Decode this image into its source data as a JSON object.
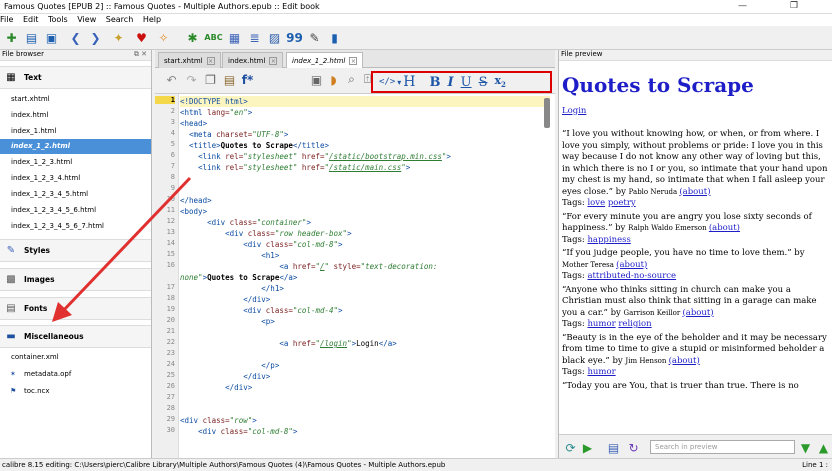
{
  "titlebar": {
    "title": "Famous Quotes [EPUB 2] :: Famous Quotes - Multiple Authors.epub :: Edit book"
  },
  "menu": [
    "File",
    "Edit",
    "Tools",
    "View",
    "Search",
    "Help"
  ],
  "left_panel": {
    "header": "File browser",
    "sections": {
      "text": "Text",
      "styles": "Styles",
      "images": "Images",
      "fonts": "Fonts",
      "misc": "Miscellaneous"
    },
    "text_files": [
      "start.xhtml",
      "index.html",
      "index_1.html",
      "index_1_2.html",
      "index_1_2_3.html",
      "index_1_2_3_4.html",
      "index_1_2_3_4_5.html",
      "index_1_2_3_4_5_6.html",
      "index_1_2_3_4_5_6_7.html"
    ],
    "misc_files": [
      "container.xml",
      "metadata.opf",
      "toc.ncx"
    ]
  },
  "tabs": [
    "start.xhtml",
    "index.html",
    "index_1_2.html"
  ],
  "editor": {
    "lines": [
      {
        "n": "1",
        "html": "<span class='t'>&lt;!DOCTYPE html&gt;</span>"
      },
      {
        "n": "2",
        "html": "<span class='t'>&lt;html</span> <span class='at'>lang=</span><span class='av'>\"en\"</span><span class='t'>&gt;</span>"
      },
      {
        "n": "3",
        "html": "<span class='t'>&lt;head&gt;</span>"
      },
      {
        "n": "4",
        "html": "  <span class='t'>&lt;meta</span> <span class='at'>charset=</span><span class='av'>\"UTF-8\"</span><span class='t'>&gt;</span>"
      },
      {
        "n": "5",
        "html": "  <span class='t'>&lt;title&gt;</span><b>Quotes to Scrape</b><span class='t'>&lt;/title&gt;</span>"
      },
      {
        "n": "6",
        "html": "    <span class='t'>&lt;link</span> <span class='at'>rel=</span><span class='av'>\"stylesheet\"</span> <span class='at'>href=</span><span class='av'>\"</span><span class='lk'>/static/bootstrap.min.css</span><span class='av'>\"</span><span class='t'>&gt;</span>"
      },
      {
        "n": "7",
        "html": "    <span class='t'>&lt;link</span> <span class='at'>rel=</span><span class='av'>\"stylesheet\"</span> <span class='at'>href=</span><span class='av'>\"</span><span class='lk'>/static/main.css</span><span class='av'>\"</span><span class='t'>&gt;</span>"
      },
      {
        "n": "8",
        "html": ""
      },
      {
        "n": "9",
        "html": ""
      },
      {
        "n": "10",
        "html": "<span class='t'>&lt;/head&gt;</span>"
      },
      {
        "n": "11",
        "html": "<span class='t'>&lt;body&gt;</span>"
      },
      {
        "n": "12",
        "html": "      <span class='t'>&lt;div</span> <span class='at'>class=</span><span class='av'>\"container\"</span><span class='t'>&gt;</span>"
      },
      {
        "n": "13",
        "html": "          <span class='t'>&lt;div</span> <span class='at'>class=</span><span class='av'>\"row header-box\"</span><span class='t'>&gt;</span>"
      },
      {
        "n": "14",
        "html": "              <span class='t'>&lt;div</span> <span class='at'>class=</span><span class='av'>\"col-md-8\"</span><span class='t'>&gt;</span>"
      },
      {
        "n": "15",
        "html": "                  <span class='t'>&lt;h1&gt;</span>"
      },
      {
        "n": "16",
        "html": "                      <span class='t'>&lt;a</span> <span class='at'>href=</span><span class='av'>\"</span><span class='lk'>/</span><span class='av'>\"</span> <span class='at'>style=</span><span class='av'>\"text-decoration:</span>"
      },
      {
        "n": "",
        "html": "<span class='av'>none\"</span><span class='t'>&gt;</span><b>Quotes to Scrape</b><span class='t'>&lt;/a&gt;</span>"
      },
      {
        "n": "17",
        "html": "                  <span class='t'>&lt;/h1&gt;</span>"
      },
      {
        "n": "18",
        "html": "              <span class='t'>&lt;/div&gt;</span>"
      },
      {
        "n": "19",
        "html": "              <span class='t'>&lt;div</span> <span class='at'>class=</span><span class='av'>\"col-md-4\"</span><span class='t'>&gt;</span>"
      },
      {
        "n": "20",
        "html": "                  <span class='t'>&lt;p&gt;</span>"
      },
      {
        "n": "21",
        "html": ""
      },
      {
        "n": "22",
        "html": "                      <span class='t'>&lt;a</span> <span class='at'>href=</span><span class='av'>\"</span><span class='lk'>/login</span><span class='av'>\"</span><span class='t'>&gt;</span>Login<span class='t'>&lt;/a&gt;</span>"
      },
      {
        "n": "23",
        "html": ""
      },
      {
        "n": "24",
        "html": "                  <span class='t'>&lt;/p&gt;</span>"
      },
      {
        "n": "25",
        "html": "              <span class='t'>&lt;/div&gt;</span>"
      },
      {
        "n": "26",
        "html": "          <span class='t'>&lt;/div&gt;</span>"
      },
      {
        "n": "27",
        "html": ""
      },
      {
        "n": "28",
        "html": ""
      },
      {
        "n": "29",
        "html": "<span class='t'>&lt;div</span> <span class='at'>class=</span><span class='av'>\"row\"</span><span class='t'>&gt;</span>"
      },
      {
        "n": "30",
        "html": "    <span class='t'>&lt;div</span> <span class='at'>class=</span><span class='av'>\"col-md-8\"</span><span class='t'>&gt;</span>"
      }
    ]
  },
  "preview": {
    "header": "File preview",
    "title": "Quotes to Scrape",
    "login": "Login",
    "quotes": [
      {
        "text": "“I love you without knowing how, or when, or from where. I love you simply, without problems or pride: I love you in this way because I do not know any other way of loving but this, in which there is no I or you, so intimate that your hand upon my chest is my hand, so intimate that when I fall asleep your eyes close.” by",
        "author": "Pablo Neruda",
        "about": "(about)",
        "tags": [
          "love",
          "poetry"
        ]
      },
      {
        "text": "“For every minute you are angry you lose sixty seconds of happiness.” by",
        "author": "Ralph Waldo Emerson",
        "about": "(about)",
        "tags": [
          "happiness"
        ]
      },
      {
        "text": "“If you judge people, you have no time to love them.” by",
        "author": "Mother Teresa",
        "about": "(about)",
        "tags": [
          "attributed-no-source"
        ]
      },
      {
        "text": "“Anyone who thinks sitting in church can make you a Christian must also think that sitting in a garage can make you a car.” by",
        "author": "Garrison Keillor",
        "about": "(about)",
        "tags": [
          "humor",
          "religion"
        ]
      },
      {
        "text": "“Beauty is in the eye of the beholder and it may be necessary from time to time to give a stupid or misinformed beholder a black eye.” by",
        "author": "Jim Henson",
        "about": "(about)",
        "tags": [
          "humor"
        ]
      },
      {
        "text": "“Today you are You, that is truer than true. There is no",
        "author": "",
        "about": "",
        "tags": []
      }
    ],
    "tags_label": "Tags:",
    "search_placeholder": "Search in preview"
  },
  "status": {
    "left": "calibre 8.15 editing: C:\\Users\\pierc\\Calibre Library\\Multiple Authors\\Famous Quotes (4)\\Famous Quotes - Multiple Authors.epub",
    "right": "Line 1 :"
  },
  "colors": {
    "accent": "#4a90d9",
    "highlight_box": "#dd0000",
    "link": "#1e1ec8",
    "arrow": "#e03030"
  }
}
